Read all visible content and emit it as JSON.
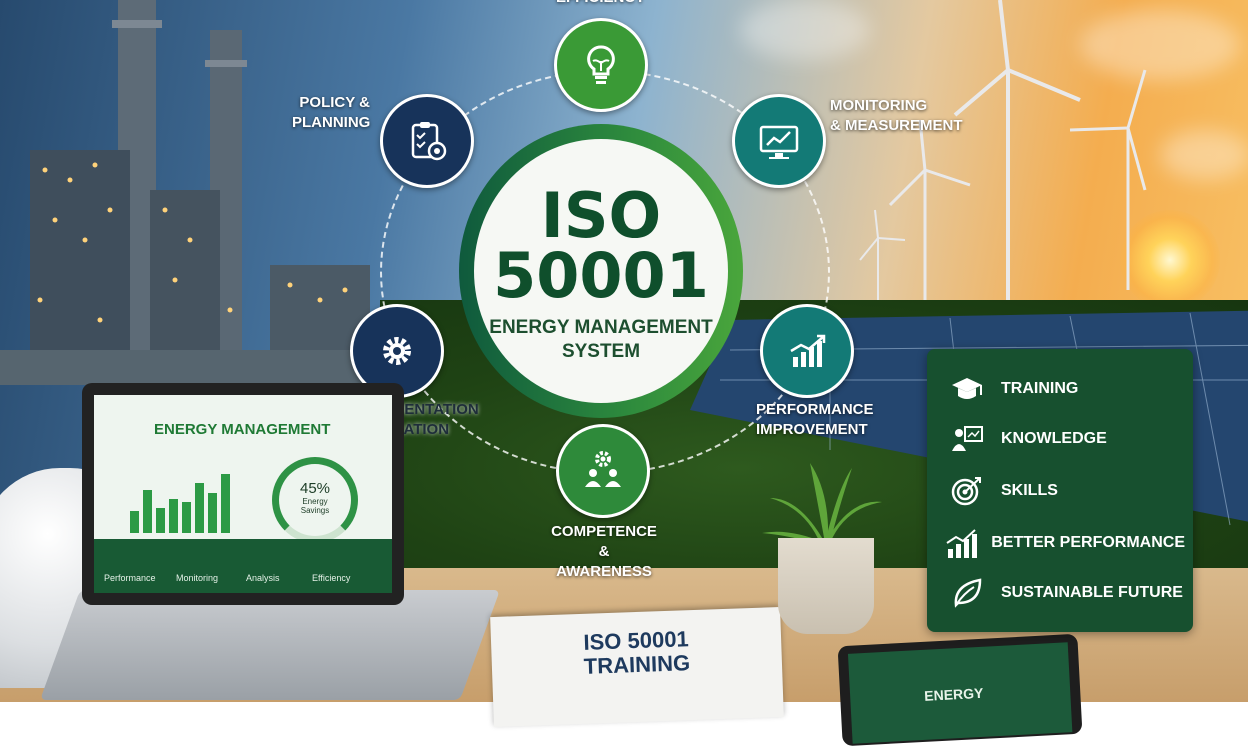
{
  "colors": {
    "brand_green": "#17502f",
    "accent_green": "#2e8b3d",
    "navy": "#17335a",
    "teal": "#137a76"
  },
  "center": {
    "line1": "ISO",
    "line2": "50001",
    "sub1": "ENERGY MANAGEMENT",
    "sub2": "SYSTEM"
  },
  "cycle": {
    "efficiency": {
      "label": "EFFICIENCY",
      "icon": "lightbulb-icon"
    },
    "policy": {
      "line1": "POLICY &",
      "line2": "PLANNING",
      "icon": "clipboard-target-icon"
    },
    "monitoring": {
      "line1": "MONITORING",
      "line2": "& MEASUREMENT",
      "icon": "monitor-chart-icon"
    },
    "implementation": {
      "line1": "IMPLEMENTATION",
      "line2": "& OPERATION",
      "icon": "gear-icon"
    },
    "performance": {
      "line1": "PERFORMANCE",
      "line2": "IMPROVEMENT",
      "icon": "growth-chart-icon"
    },
    "competence": {
      "line1": "COMPETENCE &",
      "line2": "AWARENESS",
      "icon": "people-gear-icon"
    }
  },
  "laptop": {
    "title": "ENERGY MANAGEMENT",
    "gauge_value": "45%",
    "gauge_label1": "Energy",
    "gauge_label2": "Savings",
    "gauge_level": 0.45,
    "strip": [
      "Performance",
      "Monitoring",
      "Analysis",
      "Efficiency"
    ],
    "bars": [
      0.35,
      0.7,
      0.4,
      0.55,
      0.5,
      0.8,
      0.65,
      0.95
    ]
  },
  "notebook": {
    "line1": "ISO 50001",
    "line2": "TRAINING"
  },
  "tablet": {
    "text": "ENERGY"
  },
  "benefits": [
    {
      "label": "TRAINING",
      "icon": "graduation-cap-icon"
    },
    {
      "label": "KNOWLEDGE",
      "icon": "teacher-board-icon"
    },
    {
      "label": "SKILLS",
      "icon": "target-icon"
    },
    {
      "label": "BETTER PERFORMANCE",
      "icon": "growth-chart-icon"
    },
    {
      "label": "SUSTAINABLE FUTURE",
      "icon": "leaf-icon"
    }
  ]
}
